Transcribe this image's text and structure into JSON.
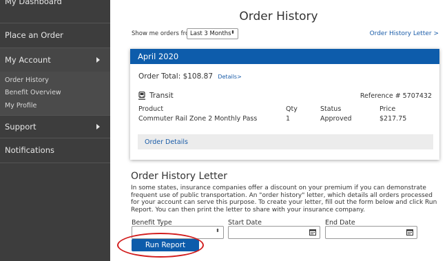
{
  "sidebar": {
    "items": [
      {
        "label": "My Dashboard"
      },
      {
        "label": "Place an Order"
      },
      {
        "label": "My Account"
      },
      {
        "label": "Support"
      },
      {
        "label": "Notifications"
      }
    ],
    "sub_items": [
      {
        "label": "Order History"
      },
      {
        "label": "Benefit Overview"
      },
      {
        "label": "My Profile"
      }
    ]
  },
  "main": {
    "title": "Order History",
    "filter": {
      "label": "Show me orders from",
      "selected": "Last 3 Months",
      "arrows": "⬍"
    },
    "letter_link": "Order History Letter >",
    "order": {
      "month": "April 2020",
      "total": "Order Total: $108.87",
      "details_link": "Details>",
      "category": "Transit",
      "reference": "Reference # 5707432",
      "headers": {
        "product": "Product",
        "qty": "Qty",
        "status": "Status",
        "price": "Price"
      },
      "row": {
        "product": "Commuter Rail Zone 2 Monthly Pass",
        "qty": "1",
        "status": "Approved",
        "price": "$217.75"
      },
      "details_button": "Order Details"
    },
    "letter": {
      "title": "Order History Letter",
      "description": "In some states, insurance companies offer a discount on your premium if you can demonstrate frequent use of public transportation. An \"order history\" letter, which details all orders processed for your account can serve this purpose. To create your letter, fill out the form below and click Run Report. You can then print the letter to share with your insurance company.",
      "benefit_type_label": "Benefit Type",
      "start_date_label": "Start Date",
      "end_date_label": "End Date",
      "run_button": "Run Report"
    }
  },
  "colors": {
    "sidebar": "#3d3d3d",
    "accent": "#0d5cab",
    "highlight": "#d21d1d"
  },
  "icons": [
    "caret-right-icon",
    "train-icon",
    "calendar-icon",
    "select-arrows-icon"
  ]
}
